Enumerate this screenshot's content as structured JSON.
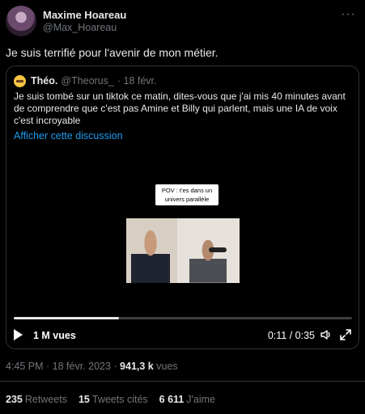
{
  "author": {
    "name": "Maxime Hoareau",
    "handle": "@Max_Hoareau"
  },
  "tweet": {
    "text": "Je suis terrifié pour l'avenir de mon métier."
  },
  "quote": {
    "name": "Théo.",
    "handle": "@Theorus_",
    "date": "· 18 févr.",
    "text": "Je suis tombé sur un tiktok ce matin, dites-vous que j'ai mis 40 minutes avant de comprendre que c'est pas Amine et Billy qui parlent, mais une IA de voix c'est incroyable",
    "link": "Afficher cette discussion",
    "video": {
      "caption": "POV : t'es dans un univers parallèle",
      "views": "1 M vues",
      "time": "0:11 / 0:35",
      "progress": 0.31
    }
  },
  "meta": {
    "datetime": "4:45 PM · 18 févr. 2023 · ",
    "views_count": "941,3 k",
    "views_label": "vues"
  },
  "stats": {
    "retweets_count": "235",
    "retweets_label": "Retweets",
    "quotes_count": "15",
    "quotes_label": "Tweets cités",
    "likes_count": "6 611",
    "likes_label": "J'aime"
  },
  "colors": {
    "background": "#000000",
    "link": "#1d9bf0",
    "muted": "#71767b",
    "border": "#2f3336"
  },
  "icons": [
    "more-icon",
    "play-icon",
    "volume-icon",
    "expand-icon"
  ]
}
